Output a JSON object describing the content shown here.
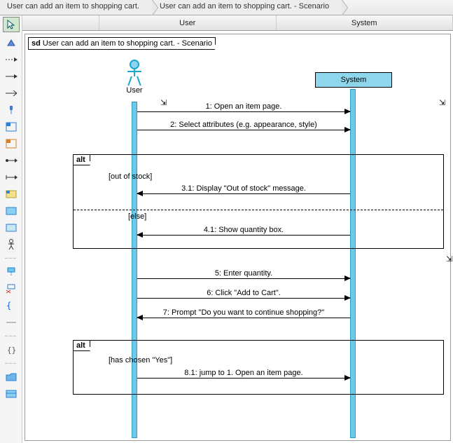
{
  "breadcrumb": {
    "item1": "User can add an item to shopping cart.",
    "item2": "User can add an item to shopping cart. - Scenario"
  },
  "lanes": {
    "user": "User",
    "system": "System"
  },
  "sd": {
    "prefix": "sd",
    "title": "User can add an item to shopping cart. - Scenario"
  },
  "actor": {
    "label": "User"
  },
  "system": {
    "label": "System"
  },
  "frag1": {
    "tag": "alt",
    "guard1": "[out of stock]",
    "guard2": "[else]"
  },
  "frag2": {
    "tag": "alt",
    "guard1": "[has chosen \"Yes\"]"
  },
  "messages": {
    "m1": "1: Open an item page.",
    "m2": "2: Select attributes (e.g. appearance, style)",
    "m31": "3.1: Display \"Out of stock\" message.",
    "m41": "4.1: Show quantity box.",
    "m5": "5: Enter quantity.",
    "m6": "6: Click \"Add to Cart\".",
    "m7": "7: Prompt \"Do you want to continue shopping?\"",
    "m81": "8.1: jump to 1. Open an item page."
  },
  "chart_data": {
    "type": "uml-sequence-diagram",
    "title": "User can add an item to shopping cart. - Scenario",
    "participants": [
      {
        "name": "User",
        "kind": "actor"
      },
      {
        "name": "System",
        "kind": "lifeline"
      }
    ],
    "interactions": [
      {
        "seq": "1",
        "from": "User",
        "to": "System",
        "label": "Open an item page."
      },
      {
        "seq": "2",
        "from": "User",
        "to": "System",
        "label": "Select attributes (e.g. appearance, style)"
      },
      {
        "fragment": "alt",
        "branches": [
          {
            "guard": "out of stock",
            "interactions": [
              {
                "seq": "3.1",
                "from": "System",
                "to": "User",
                "label": "Display \"Out of stock\" message."
              }
            ]
          },
          {
            "guard": "else",
            "interactions": [
              {
                "seq": "4.1",
                "from": "System",
                "to": "User",
                "label": "Show quantity box."
              }
            ]
          }
        ]
      },
      {
        "seq": "5",
        "from": "User",
        "to": "System",
        "label": "Enter quantity."
      },
      {
        "seq": "6",
        "from": "User",
        "to": "System",
        "label": "Click \"Add to Cart\"."
      },
      {
        "seq": "7",
        "from": "System",
        "to": "User",
        "label": "Prompt \"Do you want to continue shopping?\""
      },
      {
        "fragment": "alt",
        "branches": [
          {
            "guard": "has chosen \"Yes\"",
            "interactions": [
              {
                "seq": "8.1",
                "from": "User",
                "to": "System",
                "label": "jump to 1. Open an item page."
              }
            ]
          }
        ]
      }
    ]
  }
}
